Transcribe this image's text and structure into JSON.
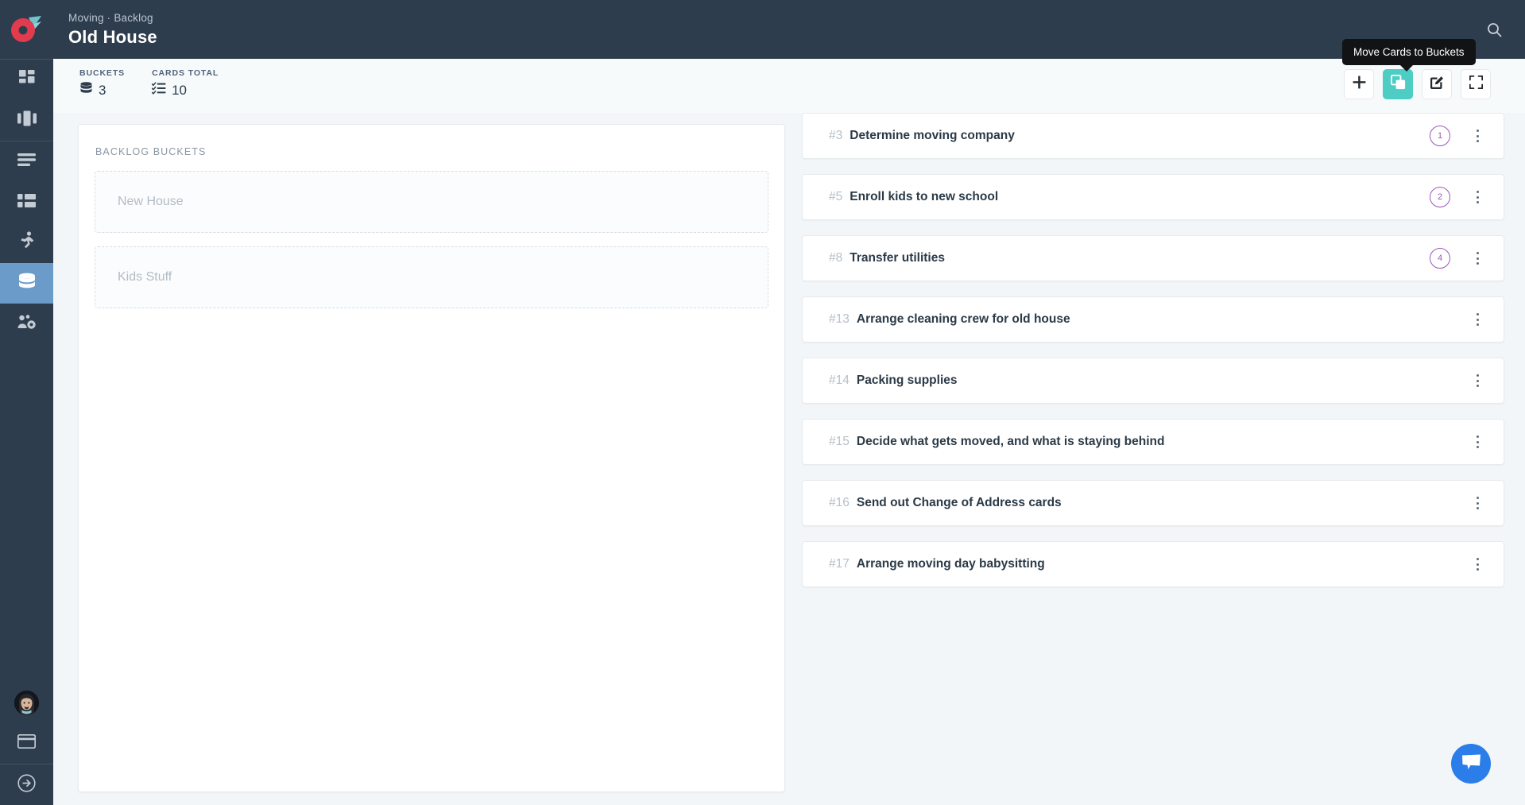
{
  "header": {
    "breadcrumb": "Moving · Backlog",
    "title": "Old House",
    "logo_name": "rocket-comet-logo",
    "search_icon": "search-icon"
  },
  "sidebar": {
    "groups": [
      {
        "items": [
          {
            "icon": "dashboard-grid-icon",
            "active": false
          },
          {
            "icon": "kanban-columns-icon",
            "active": false
          }
        ]
      },
      {
        "items": [
          {
            "icon": "list-lines-icon",
            "active": false
          },
          {
            "icon": "table-rows-icon",
            "active": false
          },
          {
            "icon": "running-person-icon",
            "active": false
          },
          {
            "icon": "database-stack-icon",
            "active": true
          },
          {
            "icon": "team-settings-icon",
            "active": false
          }
        ]
      }
    ],
    "bottom": [
      {
        "icon": "user-avatar",
        "active": false
      },
      {
        "icon": "credit-card-icon",
        "active": false
      },
      {
        "icon": "logout-arrow-icon",
        "active": false
      }
    ]
  },
  "stats": [
    {
      "label": "BUCKETS",
      "value": "3",
      "icon": "database-stack-icon"
    },
    {
      "label": "CARDS TOTAL",
      "value": "10",
      "icon": "checklist-icon"
    }
  ],
  "toolbar": {
    "buttons": [
      {
        "name": "add-button",
        "icon": "plus-icon",
        "accent": false
      },
      {
        "name": "move-cards-to-buckets-button",
        "icon": "copy-stack-icon",
        "accent": true
      },
      {
        "name": "edit-button",
        "icon": "pencil-square-icon",
        "accent": false
      },
      {
        "name": "fullscreen-button",
        "icon": "expand-corners-icon",
        "accent": false
      }
    ],
    "tooltip": "Move Cards to Buckets"
  },
  "buckets_panel": {
    "heading": "BACKLOG BUCKETS",
    "dropzones": [
      {
        "label": "New House"
      },
      {
        "label": "Kids Stuff"
      }
    ]
  },
  "cards": [
    {
      "num": "#3",
      "title": "Determine moving company",
      "badge": "1"
    },
    {
      "num": "#5",
      "title": "Enroll kids to new school",
      "badge": "2"
    },
    {
      "num": "#8",
      "title": "Transfer utilities",
      "badge": "4"
    },
    {
      "num": "#13",
      "title": "Arrange cleaning crew for old house",
      "badge": null
    },
    {
      "num": "#14",
      "title": "Packing supplies",
      "badge": null
    },
    {
      "num": "#15",
      "title": "Decide what gets moved, and what is staying behind",
      "badge": null
    },
    {
      "num": "#16",
      "title": "Send out Change of Address cards",
      "badge": null
    },
    {
      "num": "#17",
      "title": "Arrange moving day babysitting",
      "badge": null
    }
  ],
  "chat": {
    "icon": "chat-bubble-icon"
  },
  "colors": {
    "header_bg": "#2e3d4d",
    "accent_teal": "#4ecdc4",
    "active_blue": "#6a9bc9",
    "badge_purple": "#9b59b6",
    "chat_blue": "#2b7de9",
    "page_bg": "#f2f6f8"
  }
}
